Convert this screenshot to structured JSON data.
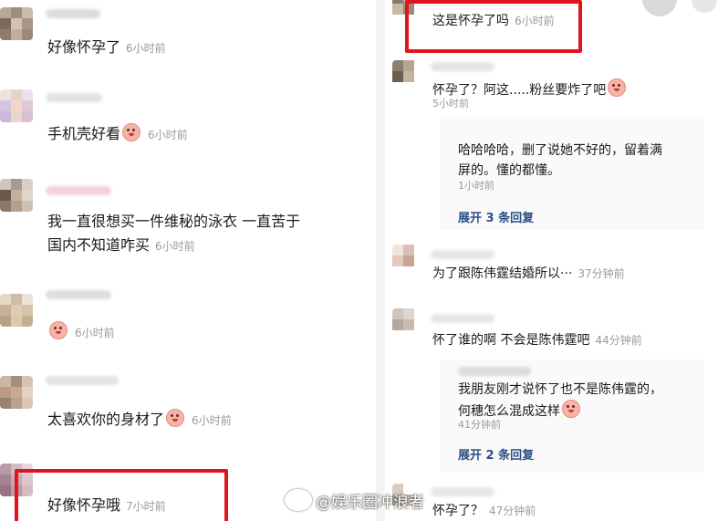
{
  "left_comments": [
    {
      "text": "好像怀孕了",
      "time": "6小时前",
      "emoji": false
    },
    {
      "text": "手机壳好看",
      "time": "6小时前",
      "emoji": true
    },
    {
      "line1": "我一直很想买一件维秘的泳衣 一直苦于",
      "line2": "国内不知道咋买",
      "time": "6小时前"
    },
    {
      "text": "",
      "time": "6小时前",
      "emoji": true
    },
    {
      "text": "太喜欢你的身材了",
      "time": "6小时前",
      "emoji": true
    },
    {
      "text": "好像怀孕哦",
      "time": "7小时前"
    }
  ],
  "right_comments": {
    "c1": {
      "text": "这是怀孕了吗",
      "time": "6小时前"
    },
    "c2": {
      "text": "怀孕了？阿这.....粉丝要炸了吧",
      "time": "5小时前",
      "reply": {
        "line1": "哈哈哈哈，删了说她不好的，留着满",
        "line2": "屏的。懂的都懂。",
        "time": "1小时前"
      },
      "expand": "展开 3 条回复"
    },
    "c3": {
      "text": "为了跟陈伟霆结婚所以···",
      "time": "37分钟前"
    },
    "c4": {
      "text": "怀了谁的啊 不会是陈伟霆吧",
      "time": "44分钟前",
      "reply": {
        "line1": "我朋友刚才说怀了也不是陈伟霆的，",
        "line2": "何穗怎么混成这样",
        "time": "41分钟前"
      },
      "expand": "展开 2 条回复"
    },
    "c5": {
      "text": "怀孕了？",
      "time": "47分钟前"
    }
  },
  "watermark": "@娱乐圈冲浪者",
  "colors": {
    "highlight": "#e1131c",
    "link": "#2a4f85",
    "time": "#9a9a9a"
  }
}
